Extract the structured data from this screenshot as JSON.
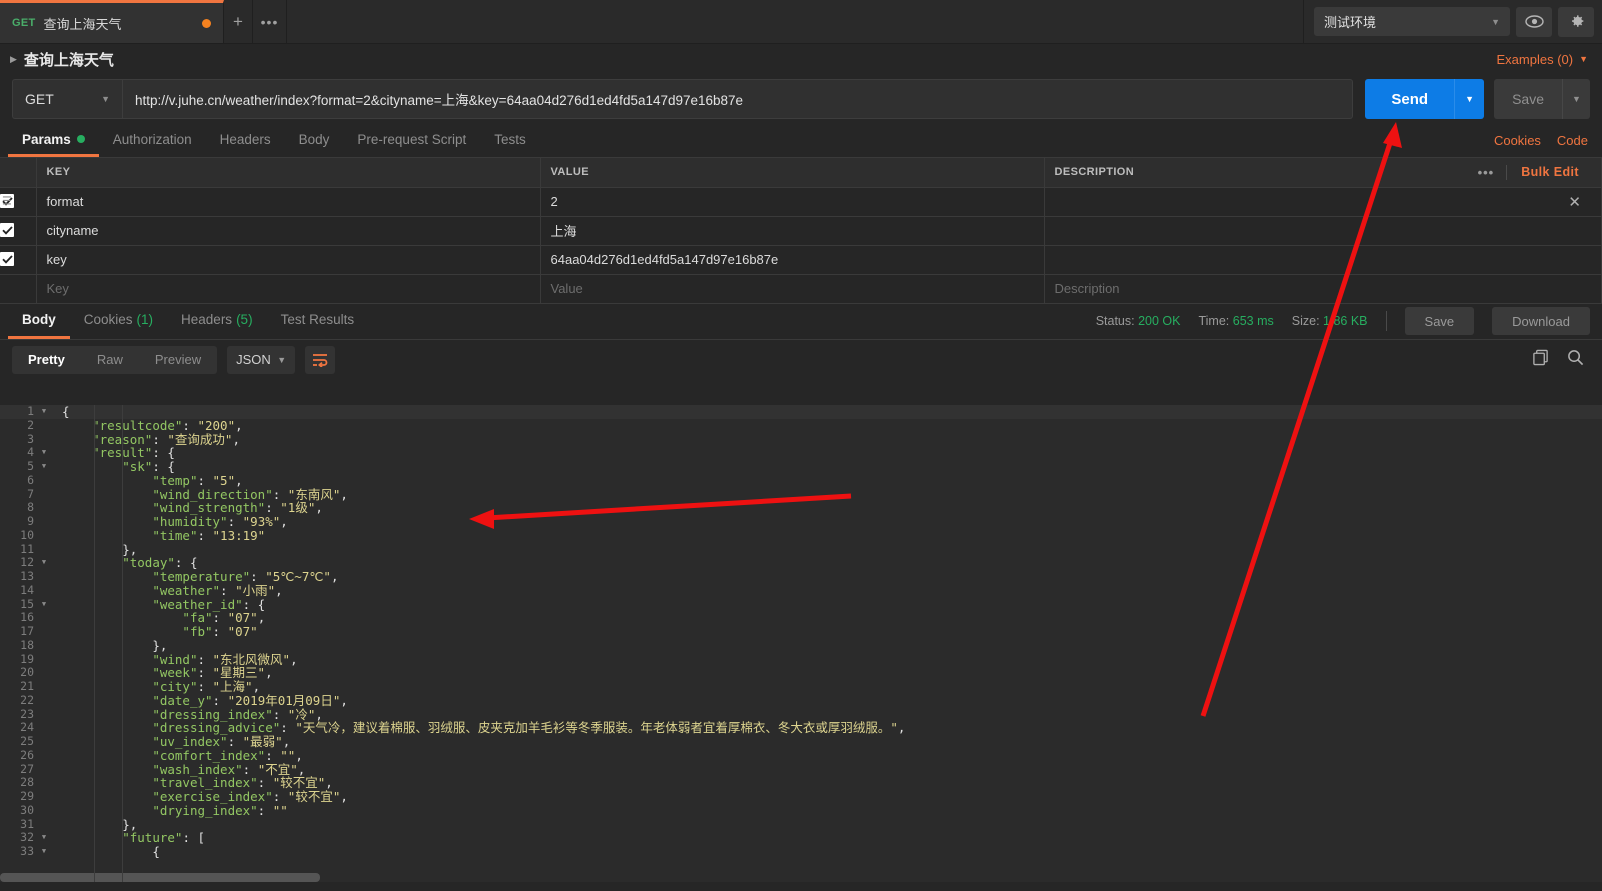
{
  "tab": {
    "method": "GET",
    "name": "查询上海天气",
    "add_label": "+",
    "more_label": "•••"
  },
  "env": {
    "selected": "测试环境",
    "eye_icon": "eye-icon",
    "gear_icon": "gear-icon"
  },
  "breadcrumb": {
    "title": "查询上海天气",
    "examples_label": "Examples (0)"
  },
  "url_bar": {
    "method": "GET",
    "url": "http://v.juhe.cn/weather/index?format=2&cityname=上海&key=64aa04d276d1ed4fd5a147d97e16b87e",
    "send_label": "Send",
    "save_label": "Save"
  },
  "request_tabs": {
    "items": [
      {
        "label": "Params",
        "active": true,
        "dot": true
      },
      {
        "label": "Authorization",
        "active": false,
        "dot": false
      },
      {
        "label": "Headers",
        "active": false,
        "dot": false
      },
      {
        "label": "Body",
        "active": false,
        "dot": false
      },
      {
        "label": "Pre-request Script",
        "active": false,
        "dot": false
      },
      {
        "label": "Tests",
        "active": false,
        "dot": false
      }
    ],
    "cookies_label": "Cookies",
    "code_label": "Code"
  },
  "params_table": {
    "headers": {
      "key": "KEY",
      "value": "VALUE",
      "description": "DESCRIPTION"
    },
    "tools": {
      "dots": "•••",
      "bulk_edit": "Bulk Edit"
    },
    "rows": [
      {
        "checked": true,
        "key": "format",
        "value": "2",
        "description": "",
        "placeholder": false
      },
      {
        "checked": true,
        "key": "cityname",
        "value": "上海",
        "description": "",
        "placeholder": false
      },
      {
        "checked": true,
        "key": "key",
        "value": "64aa04d276d1ed4fd5a147d97e16b87e",
        "description": "",
        "placeholder": false
      },
      {
        "checked": false,
        "key": "Key",
        "value": "Value",
        "description": "Description",
        "placeholder": true
      }
    ]
  },
  "response_tabs": {
    "items": [
      {
        "label": "Body",
        "count": "",
        "active": true
      },
      {
        "label": "Cookies",
        "count": "(1)",
        "active": false
      },
      {
        "label": "Headers",
        "count": "(5)",
        "active": false
      },
      {
        "label": "Test Results",
        "count": "",
        "active": false
      }
    ]
  },
  "response_meta": {
    "status_label": "Status:",
    "status_value": "200 OK",
    "time_label": "Time:",
    "time_value": "653 ms",
    "size_label": "Size:",
    "size_value": "1.86 KB",
    "save_label": "Save",
    "download_label": "Download"
  },
  "body_toolbar": {
    "modes": [
      {
        "label": "Pretty",
        "active": true
      },
      {
        "label": "Raw",
        "active": false
      },
      {
        "label": "Preview",
        "active": false
      }
    ],
    "format": "JSON",
    "wrap_icon": "word-wrap-icon",
    "copy_icon": "copy-icon",
    "search_icon": "search-icon"
  },
  "json_body": {
    "lines": [
      {
        "n": 1,
        "fold": true,
        "indent": 0,
        "parts": [
          {
            "t": "p",
            "v": "{"
          }
        ]
      },
      {
        "n": 2,
        "fold": false,
        "indent": 1,
        "parts": [
          {
            "t": "k",
            "v": "\"resultcode\""
          },
          {
            "t": "p",
            "v": ": "
          },
          {
            "t": "s",
            "v": "\"200\""
          },
          {
            "t": "p",
            "v": ","
          }
        ]
      },
      {
        "n": 3,
        "fold": false,
        "indent": 1,
        "parts": [
          {
            "t": "k",
            "v": "\"reason\""
          },
          {
            "t": "p",
            "v": ": "
          },
          {
            "t": "s",
            "v": "\"查询成功\""
          },
          {
            "t": "p",
            "v": ","
          }
        ]
      },
      {
        "n": 4,
        "fold": true,
        "indent": 1,
        "parts": [
          {
            "t": "k",
            "v": "\"result\""
          },
          {
            "t": "p",
            "v": ": {"
          }
        ]
      },
      {
        "n": 5,
        "fold": true,
        "indent": 2,
        "parts": [
          {
            "t": "k",
            "v": "\"sk\""
          },
          {
            "t": "p",
            "v": ": {"
          }
        ]
      },
      {
        "n": 6,
        "fold": false,
        "indent": 3,
        "parts": [
          {
            "t": "k",
            "v": "\"temp\""
          },
          {
            "t": "p",
            "v": ": "
          },
          {
            "t": "s",
            "v": "\"5\""
          },
          {
            "t": "p",
            "v": ","
          }
        ]
      },
      {
        "n": 7,
        "fold": false,
        "indent": 3,
        "parts": [
          {
            "t": "k",
            "v": "\"wind_direction\""
          },
          {
            "t": "p",
            "v": ": "
          },
          {
            "t": "s",
            "v": "\"东南风\""
          },
          {
            "t": "p",
            "v": ","
          }
        ]
      },
      {
        "n": 8,
        "fold": false,
        "indent": 3,
        "parts": [
          {
            "t": "k",
            "v": "\"wind_strength\""
          },
          {
            "t": "p",
            "v": ": "
          },
          {
            "t": "s",
            "v": "\"1级\""
          },
          {
            "t": "p",
            "v": ","
          }
        ]
      },
      {
        "n": 9,
        "fold": false,
        "indent": 3,
        "parts": [
          {
            "t": "k",
            "v": "\"humidity\""
          },
          {
            "t": "p",
            "v": ": "
          },
          {
            "t": "s",
            "v": "\"93%\""
          },
          {
            "t": "p",
            "v": ","
          }
        ]
      },
      {
        "n": 10,
        "fold": false,
        "indent": 3,
        "parts": [
          {
            "t": "k",
            "v": "\"time\""
          },
          {
            "t": "p",
            "v": ": "
          },
          {
            "t": "s",
            "v": "\"13:19\""
          }
        ]
      },
      {
        "n": 11,
        "fold": false,
        "indent": 2,
        "parts": [
          {
            "t": "p",
            "v": "},"
          }
        ]
      },
      {
        "n": 12,
        "fold": true,
        "indent": 2,
        "parts": [
          {
            "t": "k",
            "v": "\"today\""
          },
          {
            "t": "p",
            "v": ": {"
          }
        ]
      },
      {
        "n": 13,
        "fold": false,
        "indent": 3,
        "parts": [
          {
            "t": "k",
            "v": "\"temperature\""
          },
          {
            "t": "p",
            "v": ": "
          },
          {
            "t": "s",
            "v": "\"5℃~7℃\""
          },
          {
            "t": "p",
            "v": ","
          }
        ]
      },
      {
        "n": 14,
        "fold": false,
        "indent": 3,
        "parts": [
          {
            "t": "k",
            "v": "\"weather\""
          },
          {
            "t": "p",
            "v": ": "
          },
          {
            "t": "s",
            "v": "\"小雨\""
          },
          {
            "t": "p",
            "v": ","
          }
        ]
      },
      {
        "n": 15,
        "fold": true,
        "indent": 3,
        "parts": [
          {
            "t": "k",
            "v": "\"weather_id\""
          },
          {
            "t": "p",
            "v": ": {"
          }
        ]
      },
      {
        "n": 16,
        "fold": false,
        "indent": 4,
        "parts": [
          {
            "t": "k",
            "v": "\"fa\""
          },
          {
            "t": "p",
            "v": ": "
          },
          {
            "t": "s",
            "v": "\"07\""
          },
          {
            "t": "p",
            "v": ","
          }
        ]
      },
      {
        "n": 17,
        "fold": false,
        "indent": 4,
        "parts": [
          {
            "t": "k",
            "v": "\"fb\""
          },
          {
            "t": "p",
            "v": ": "
          },
          {
            "t": "s",
            "v": "\"07\""
          }
        ]
      },
      {
        "n": 18,
        "fold": false,
        "indent": 3,
        "parts": [
          {
            "t": "p",
            "v": "},"
          }
        ]
      },
      {
        "n": 19,
        "fold": false,
        "indent": 3,
        "parts": [
          {
            "t": "k",
            "v": "\"wind\""
          },
          {
            "t": "p",
            "v": ": "
          },
          {
            "t": "s",
            "v": "\"东北风微风\""
          },
          {
            "t": "p",
            "v": ","
          }
        ]
      },
      {
        "n": 20,
        "fold": false,
        "indent": 3,
        "parts": [
          {
            "t": "k",
            "v": "\"week\""
          },
          {
            "t": "p",
            "v": ": "
          },
          {
            "t": "s",
            "v": "\"星期三\""
          },
          {
            "t": "p",
            "v": ","
          }
        ]
      },
      {
        "n": 21,
        "fold": false,
        "indent": 3,
        "parts": [
          {
            "t": "k",
            "v": "\"city\""
          },
          {
            "t": "p",
            "v": ": "
          },
          {
            "t": "s",
            "v": "\"上海\""
          },
          {
            "t": "p",
            "v": ","
          }
        ]
      },
      {
        "n": 22,
        "fold": false,
        "indent": 3,
        "parts": [
          {
            "t": "k",
            "v": "\"date_y\""
          },
          {
            "t": "p",
            "v": ": "
          },
          {
            "t": "s",
            "v": "\"2019年01月09日\""
          },
          {
            "t": "p",
            "v": ","
          }
        ]
      },
      {
        "n": 23,
        "fold": false,
        "indent": 3,
        "parts": [
          {
            "t": "k",
            "v": "\"dressing_index\""
          },
          {
            "t": "p",
            "v": ": "
          },
          {
            "t": "s",
            "v": "\"冷\""
          },
          {
            "t": "p",
            "v": ","
          }
        ]
      },
      {
        "n": 24,
        "fold": false,
        "indent": 3,
        "parts": [
          {
            "t": "k",
            "v": "\"dressing_advice\""
          },
          {
            "t": "p",
            "v": ": "
          },
          {
            "t": "s",
            "v": "\"天气冷，建议着棉服、羽绒服、皮夹克加羊毛衫等冬季服装。年老体弱者宜着厚棉衣、冬大衣或厚羽绒服。\""
          },
          {
            "t": "p",
            "v": ","
          }
        ]
      },
      {
        "n": 25,
        "fold": false,
        "indent": 3,
        "parts": [
          {
            "t": "k",
            "v": "\"uv_index\""
          },
          {
            "t": "p",
            "v": ": "
          },
          {
            "t": "s",
            "v": "\"最弱\""
          },
          {
            "t": "p",
            "v": ","
          }
        ]
      },
      {
        "n": 26,
        "fold": false,
        "indent": 3,
        "parts": [
          {
            "t": "k",
            "v": "\"comfort_index\""
          },
          {
            "t": "p",
            "v": ": "
          },
          {
            "t": "s",
            "v": "\"\""
          },
          {
            "t": "p",
            "v": ","
          }
        ]
      },
      {
        "n": 27,
        "fold": false,
        "indent": 3,
        "parts": [
          {
            "t": "k",
            "v": "\"wash_index\""
          },
          {
            "t": "p",
            "v": ": "
          },
          {
            "t": "s",
            "v": "\"不宜\""
          },
          {
            "t": "p",
            "v": ","
          }
        ]
      },
      {
        "n": 28,
        "fold": false,
        "indent": 3,
        "parts": [
          {
            "t": "k",
            "v": "\"travel_index\""
          },
          {
            "t": "p",
            "v": ": "
          },
          {
            "t": "s",
            "v": "\"较不宜\""
          },
          {
            "t": "p",
            "v": ","
          }
        ]
      },
      {
        "n": 29,
        "fold": false,
        "indent": 3,
        "parts": [
          {
            "t": "k",
            "v": "\"exercise_index\""
          },
          {
            "t": "p",
            "v": ": "
          },
          {
            "t": "s",
            "v": "\"较不宜\""
          },
          {
            "t": "p",
            "v": ","
          }
        ]
      },
      {
        "n": 30,
        "fold": false,
        "indent": 3,
        "parts": [
          {
            "t": "k",
            "v": "\"drying_index\""
          },
          {
            "t": "p",
            "v": ": "
          },
          {
            "t": "s",
            "v": "\"\""
          }
        ]
      },
      {
        "n": 31,
        "fold": false,
        "indent": 2,
        "parts": [
          {
            "t": "p",
            "v": "},"
          }
        ]
      },
      {
        "n": 32,
        "fold": true,
        "indent": 2,
        "parts": [
          {
            "t": "k",
            "v": "\"future\""
          },
          {
            "t": "p",
            "v": ": ["
          }
        ]
      },
      {
        "n": 33,
        "fold": true,
        "indent": 3,
        "parts": [
          {
            "t": "p",
            "v": "{"
          }
        ]
      }
    ]
  },
  "annotations": {
    "arrow_to_send": "red-arrow-pointing-to-send-button",
    "arrow_to_json": "red-arrow-pointing-to-response-body"
  },
  "colors": {
    "accent": "#f07540",
    "send_blue": "#0d7ce6",
    "status_green": "#27ae60",
    "json_key": "#93c763",
    "json_string": "#ddd48f",
    "annotation_red": "#ee1111"
  }
}
